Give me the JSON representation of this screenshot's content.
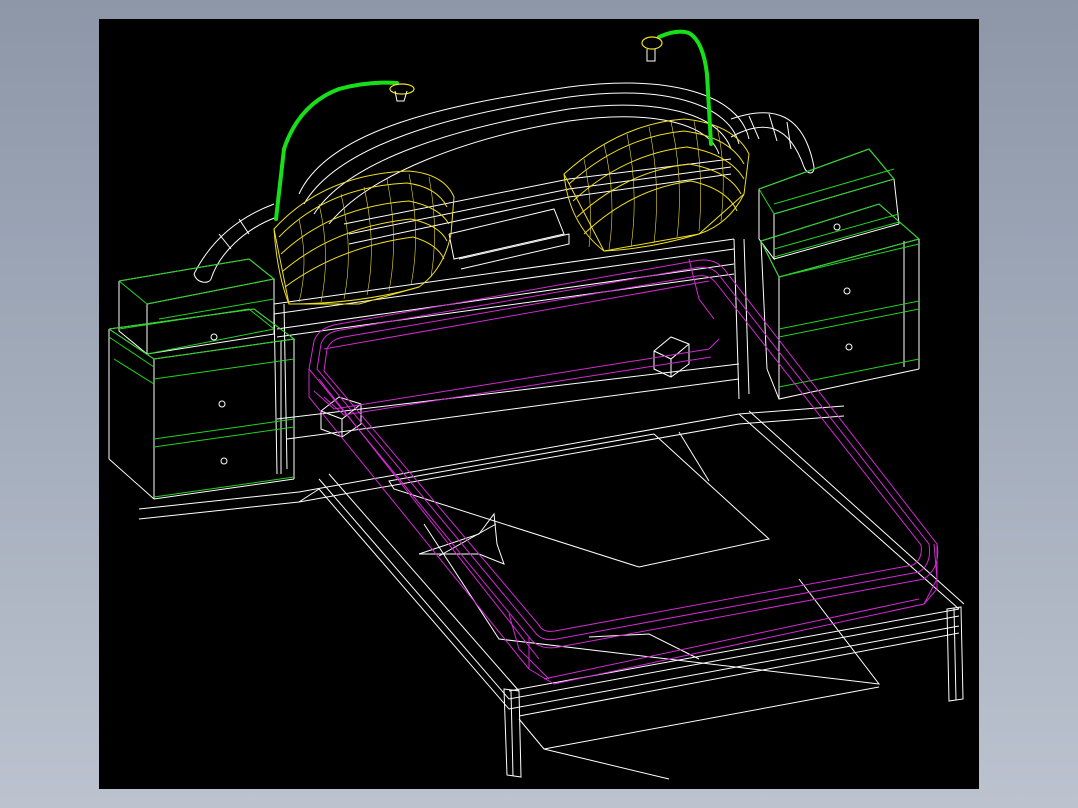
{
  "viewport": {
    "background": "#000000",
    "colors": {
      "frame": "#ffffff",
      "cabinet_edge": "#22d322",
      "lamp_arm": "#18e018",
      "mattress": "#d12ad1",
      "pillow": "#f0e020"
    }
  }
}
